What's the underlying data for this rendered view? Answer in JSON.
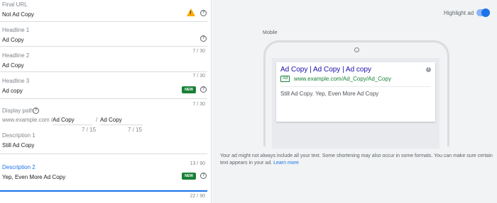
{
  "form": {
    "final_url": {
      "label": "Final URL",
      "value": "Not Ad Copy"
    },
    "headline1": {
      "label": "Headline 1",
      "value": "Ad Copy",
      "count": "7 / 30"
    },
    "headline2": {
      "label": "Headline 2",
      "value": "Ad Copy",
      "count": "7 / 30"
    },
    "headline3": {
      "label": "Headline 3",
      "value": "Ad copy",
      "badge": "NEW",
      "count": "7 / 30"
    },
    "display_path": {
      "label": "Display path",
      "domain": "www.example.com /",
      "path1": "Ad Copy",
      "sep": "/",
      "path2": "Ad Copy",
      "count1": "7 / 15",
      "count2": "7 / 15"
    },
    "description1": {
      "label": "Description 1",
      "value": "Still Ad Copy",
      "count": "13 / 90"
    },
    "description2": {
      "label": "Description 2",
      "value": "Yep, Even More Ad Copy",
      "badge": "NEW",
      "count": "22 / 90"
    }
  },
  "preview": {
    "highlight_label": "Highlight ad",
    "highlight_on": true,
    "device_label": "Mobile",
    "ad": {
      "headline": "Ad Copy | Ad Copy | Ad copy",
      "badge": "Ad",
      "url": "www.example.com/Ad_Copy/Ad_Copy",
      "description": "Still Ad Copy. Yep, Even More Ad Copy"
    },
    "note": "Your ad might not always include all your text. Some shortening may also occur in some formats. You can make sure certain text appears in your ad.",
    "learn_more": "Learn more"
  },
  "colors": {
    "accent": "#1a73e8",
    "new_badge": "#188038",
    "warning": "#f9ab00"
  },
  "icons": {
    "help": "help-icon",
    "warning": "warning-icon",
    "info": "info-icon"
  }
}
